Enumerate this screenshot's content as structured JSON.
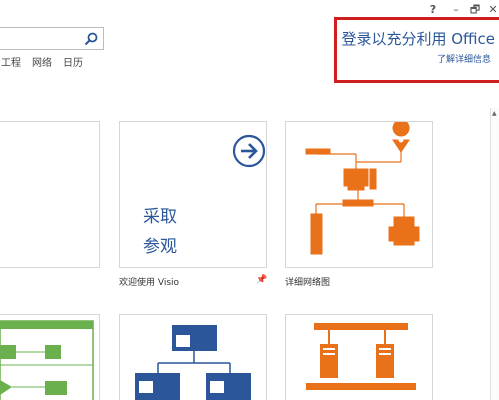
{
  "window": {
    "help_label": "?",
    "minimize_label": "–",
    "restore_label": "🗗",
    "close_label": "✕"
  },
  "search": {
    "value": "",
    "placeholder": ""
  },
  "categories": [
    "工程",
    "网络",
    "日历"
  ],
  "account": {
    "signin_text": "登录以充分利用 Office",
    "learn_more": "了解详细信息"
  },
  "templates": [
    {
      "label": "欢迎使用 Visio",
      "title_line1": "采取",
      "title_line2": "参观"
    },
    {
      "label": "详细网络图"
    }
  ],
  "colors": {
    "accent": "#2b579a",
    "orange": "#e8711a",
    "green": "#6ab04c",
    "highlight_border": "#d11f1f"
  }
}
